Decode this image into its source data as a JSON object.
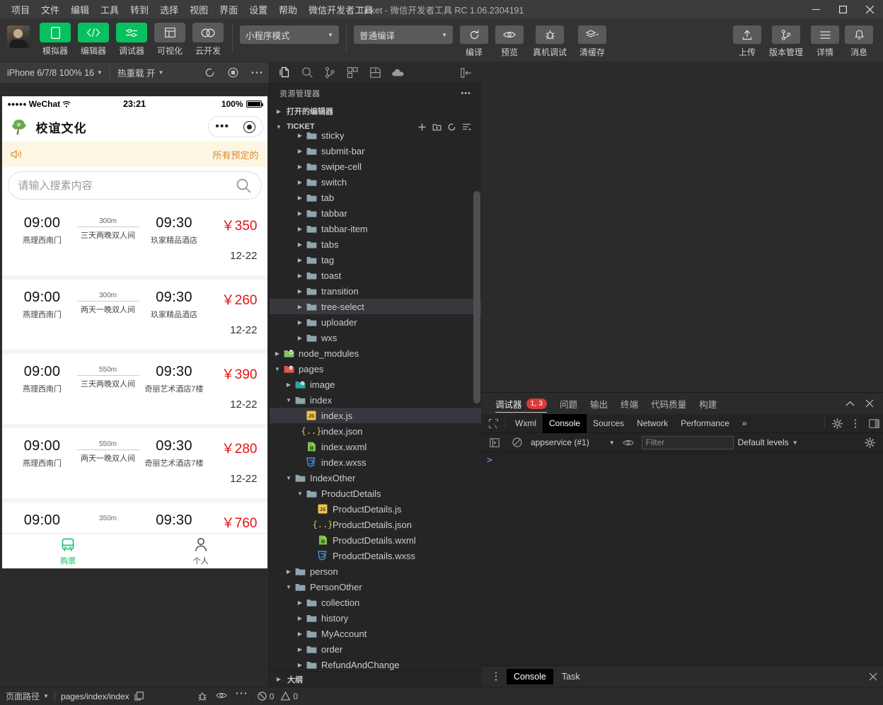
{
  "window": {
    "title": "Ticket - 微信开发者工具 RC 1.06.2304191",
    "menus": [
      "项目",
      "文件",
      "编辑",
      "工具",
      "转到",
      "选择",
      "视图",
      "界面",
      "设置",
      "帮助",
      "微信开发者工具"
    ],
    "controls": {
      "minimize": "minimize-icon",
      "maximize": "maximize-icon",
      "close": "close-icon"
    }
  },
  "toolbar": {
    "mode_buttons": [
      {
        "label": "模拟器",
        "icon": "phone-icon",
        "state": "active"
      },
      {
        "label": "编辑器",
        "icon": "code-icon",
        "state": "active"
      },
      {
        "label": "调试器",
        "icon": "sliders-icon",
        "state": "active"
      },
      {
        "label": "可视化",
        "icon": "layout-icon",
        "state": "inactive"
      },
      {
        "label": "云开发",
        "icon": "cloud-icon",
        "state": "inactive"
      }
    ],
    "mode_select": "小程序模式",
    "compile_select": "普通编译",
    "actions": [
      {
        "label": "编译",
        "icon": "refresh-icon"
      },
      {
        "label": "预览",
        "icon": "eye-icon"
      },
      {
        "label": "真机调试",
        "icon": "bug-icon"
      },
      {
        "label": "清缓存",
        "icon": "layers-icon"
      }
    ],
    "right_actions": [
      {
        "label": "上传",
        "icon": "upload-icon"
      },
      {
        "label": "版本管理",
        "icon": "branch-icon"
      },
      {
        "label": "详情",
        "icon": "menu-icon"
      },
      {
        "label": "消息",
        "icon": "bell-icon"
      }
    ]
  },
  "simulator": {
    "device": "iPhone 6/7/8 100% 16",
    "hot_reload": "热重载 开",
    "icons": [
      "refresh-icon",
      "record-icon",
      "more-icon"
    ],
    "phone": {
      "status": {
        "carrier": "WeChat",
        "signal_dots": "●●●●●",
        "wifi": "wifi-icon",
        "time": "23:21",
        "battery_pct": "100%"
      },
      "nav_title": "校谊文化",
      "notice": {
        "icon": "speaker-icon",
        "text": "所有预定的"
      },
      "search_placeholder": "请输入搜素内容",
      "tickets": [
        {
          "depart_time": "09:00",
          "depart_place": "燕理西南门",
          "distance": "300m",
          "plan": "三天两晚双人间",
          "arrive_time": "09:30",
          "arrive_place": "玖家精品酒店",
          "price": "￥350",
          "date": "12-22"
        },
        {
          "depart_time": "09:00",
          "depart_place": "燕理西南门",
          "distance": "300m",
          "plan": "两天一晚双人间",
          "arrive_time": "09:30",
          "arrive_place": "玖家精品酒店",
          "price": "￥260",
          "date": "12-22"
        },
        {
          "depart_time": "09:00",
          "depart_place": "燕理西南门",
          "distance": "550m",
          "plan": "三天两晚双人间",
          "arrive_time": "09:30",
          "arrive_place": "奇丽艺术酒店7楼",
          "price": "￥390",
          "date": "12-22"
        },
        {
          "depart_time": "09:00",
          "depart_place": "燕理西南门",
          "distance": "550m",
          "plan": "两天一晚双人间",
          "arrive_time": "09:30",
          "arrive_place": "奇丽艺术酒店7楼",
          "price": "￥280",
          "date": "12-22"
        },
        {
          "depart_time": "09:00",
          "depart_place": "",
          "distance": "350m",
          "plan": "",
          "arrive_time": "09:30",
          "arrive_place": "",
          "price": "￥760",
          "date": ""
        }
      ],
      "tabbar": [
        {
          "label": "购票",
          "icon": "bus-icon",
          "active": true
        },
        {
          "label": "个人",
          "icon": "person-icon",
          "active": false
        }
      ]
    }
  },
  "explorer": {
    "activity_icons": [
      "files-icon",
      "search-icon",
      "source-control-icon",
      "extensions-icon",
      "save-icon",
      "cloud-dev-icon",
      "collapse-panel-icon"
    ],
    "title": "资源管理器",
    "title_more": "more-icon",
    "open_editors": "打开的编辑器",
    "project_name": "TICKET",
    "project_actions": [
      "new-file-icon",
      "new-folder-icon",
      "refresh-icon",
      "collapse-all-icon"
    ],
    "outline": "大纲",
    "tree": [
      {
        "label": "sticky",
        "type": "folder",
        "depth": 3,
        "state": "collapsed",
        "clipped": true
      },
      {
        "label": "submit-bar",
        "type": "folder",
        "depth": 3,
        "state": "collapsed"
      },
      {
        "label": "swipe-cell",
        "type": "folder",
        "depth": 3,
        "state": "collapsed"
      },
      {
        "label": "switch",
        "type": "folder",
        "depth": 3,
        "state": "collapsed"
      },
      {
        "label": "tab",
        "type": "folder",
        "depth": 3,
        "state": "collapsed"
      },
      {
        "label": "tabbar",
        "type": "folder",
        "depth": 3,
        "state": "collapsed"
      },
      {
        "label": "tabbar-item",
        "type": "folder",
        "depth": 3,
        "state": "collapsed"
      },
      {
        "label": "tabs",
        "type": "folder",
        "depth": 3,
        "state": "collapsed"
      },
      {
        "label": "tag",
        "type": "folder",
        "depth": 3,
        "state": "collapsed"
      },
      {
        "label": "toast",
        "type": "folder",
        "depth": 3,
        "state": "collapsed"
      },
      {
        "label": "transition",
        "type": "folder",
        "depth": 3,
        "state": "collapsed"
      },
      {
        "label": "tree-select",
        "type": "folder",
        "depth": 3,
        "state": "collapsed",
        "highlight": "hovered"
      },
      {
        "label": "uploader",
        "type": "folder",
        "depth": 3,
        "state": "collapsed"
      },
      {
        "label": "wxs",
        "type": "folder",
        "depth": 3,
        "state": "collapsed"
      },
      {
        "label": "node_modules",
        "type": "folder-special",
        "depth": 1,
        "state": "collapsed"
      },
      {
        "label": "pages",
        "type": "folder-pages",
        "depth": 1,
        "state": "expanded"
      },
      {
        "label": "image",
        "type": "folder-image",
        "depth": 2,
        "state": "collapsed"
      },
      {
        "label": "index",
        "type": "folder",
        "depth": 2,
        "state": "expanded"
      },
      {
        "label": "index.js",
        "type": "js",
        "depth": 3,
        "highlight": "selected"
      },
      {
        "label": "index.json",
        "type": "json",
        "depth": 3
      },
      {
        "label": "index.wxml",
        "type": "wxml",
        "depth": 3
      },
      {
        "label": "index.wxss",
        "type": "wxss",
        "depth": 3
      },
      {
        "label": "IndexOther",
        "type": "folder",
        "depth": 2,
        "state": "expanded"
      },
      {
        "label": "ProductDetails",
        "type": "folder",
        "depth": 3,
        "state": "expanded"
      },
      {
        "label": "ProductDetails.js",
        "type": "js",
        "depth": 4
      },
      {
        "label": "ProductDetails.json",
        "type": "json",
        "depth": 4
      },
      {
        "label": "ProductDetails.wxml",
        "type": "wxml",
        "depth": 4
      },
      {
        "label": "ProductDetails.wxss",
        "type": "wxss",
        "depth": 4
      },
      {
        "label": "person",
        "type": "folder",
        "depth": 2,
        "state": "collapsed"
      },
      {
        "label": "PersonOther",
        "type": "folder",
        "depth": 2,
        "state": "expanded"
      },
      {
        "label": "collection",
        "type": "folder",
        "depth": 3,
        "state": "collapsed"
      },
      {
        "label": "history",
        "type": "folder",
        "depth": 3,
        "state": "collapsed"
      },
      {
        "label": "MyAccount",
        "type": "folder",
        "depth": 3,
        "state": "collapsed"
      },
      {
        "label": "order",
        "type": "folder",
        "depth": 3,
        "state": "collapsed"
      },
      {
        "label": "RefundAndChange",
        "type": "folder",
        "depth": 3,
        "state": "collapsed",
        "clipped": true
      }
    ]
  },
  "panel": {
    "tabs": [
      {
        "label": "调试器",
        "badge": "1, 3",
        "active": true
      },
      {
        "label": "问题",
        "active": false
      },
      {
        "label": "输出",
        "active": false
      },
      {
        "label": "终端",
        "active": false
      },
      {
        "label": "代码质量",
        "active": false
      },
      {
        "label": "构建",
        "active": false
      }
    ],
    "collapse_icon": "chevron-up-icon",
    "close_icon": "close-icon",
    "devtools_tabs": [
      {
        "label": "Wxml",
        "active": false
      },
      {
        "label": "Console",
        "active": true
      },
      {
        "label": "Sources",
        "active": false
      },
      {
        "label": "Network",
        "active": false
      },
      {
        "label": "Performance",
        "active": false
      }
    ],
    "devtools_more": "»",
    "devtools_right_icons": [
      "gear-icon",
      "kebab-icon",
      "dock-icon"
    ],
    "inspect_icon": "inspect-icon",
    "console": {
      "clear_icon": "clear-icon",
      "context": "appservice (#1)",
      "eye_icon": "eye-icon",
      "filter_placeholder": "Filter",
      "levels": "Default levels",
      "settings_icon": "gear-icon",
      "prompt": ">"
    }
  },
  "drawer": {
    "handle": "kebab-icon",
    "tabs": [
      {
        "label": "Console",
        "active": true
      },
      {
        "label": "Task",
        "active": false
      }
    ],
    "close_icon": "close-icon"
  },
  "statusbar": {
    "page_path_label": "页面路径",
    "page_path": "pages/index/index",
    "copy_icon": "copy-icon",
    "icons": [
      "bug-icon",
      "eye-icon",
      "more-icon"
    ],
    "errors": "0",
    "warnings": "0"
  },
  "colors": {
    "accent_green": "#07c160",
    "price_red": "#e21414",
    "notice_bg": "#fdf6e3",
    "notice_text": "#d98b2b",
    "badge_red": "#d83b3b"
  }
}
